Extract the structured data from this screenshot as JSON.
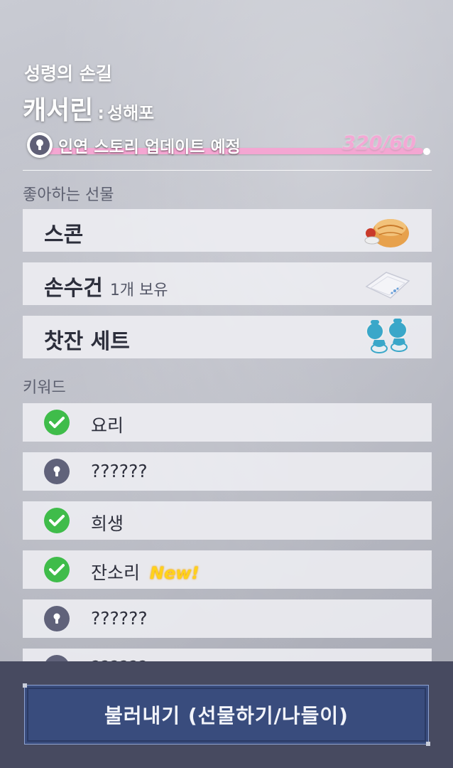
{
  "header": {
    "subtitle": "성령의 손길",
    "character_name": "캐서린",
    "separator": ":",
    "character_title": "성해포"
  },
  "bond": {
    "status_text": "인연 스토리 업데이트 예정",
    "count": "320/60",
    "progress": 1.0,
    "bar_color": "#f6c3e1"
  },
  "gifts": {
    "title": "좋아하는 선물",
    "items": [
      {
        "label": "스콘",
        "owned": "",
        "icon": "scone-icon"
      },
      {
        "label": "손수건",
        "owned": "1개 보유",
        "icon": "handkerchief-icon"
      },
      {
        "label": "찻잔 세트",
        "owned": "",
        "icon": "teacup-set-icon"
      }
    ]
  },
  "keywords": {
    "title": "키워드",
    "items": [
      {
        "label": "요리",
        "state": "unlocked",
        "badge": ""
      },
      {
        "label": "??????",
        "state": "locked",
        "badge": ""
      },
      {
        "label": "희생",
        "state": "unlocked",
        "badge": ""
      },
      {
        "label": "잔소리",
        "state": "unlocked",
        "badge": "New!"
      },
      {
        "label": "??????",
        "state": "locked",
        "badge": ""
      },
      {
        "label": "??????",
        "state": "locked",
        "badge": ""
      }
    ]
  },
  "footer": {
    "button_label": "불러내기 (선물하기/나들이)"
  },
  "colors": {
    "check": "#3fbc4a",
    "lock": "#60627a",
    "button": "#394c7d",
    "panel": "#474a60",
    "new_badge": "#ffd21a"
  }
}
